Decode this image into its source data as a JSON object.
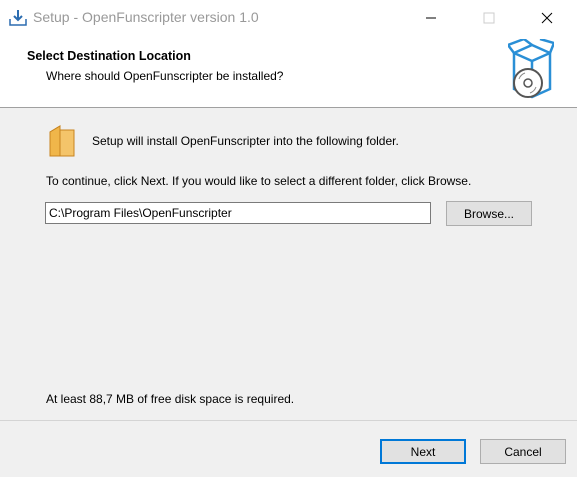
{
  "window": {
    "title": "Setup - OpenFunscripter version 1.0",
    "icon": "installer-download-icon",
    "controls": [
      "minimize-icon",
      "maximize-icon",
      "close-icon"
    ]
  },
  "header": {
    "title": "Select Destination Location",
    "subtitle": "Where should OpenFunscripter be installed?",
    "art_icon": "box-with-disc-icon"
  },
  "body": {
    "folder_icon": "folder-icon",
    "intro": "Setup will install OpenFunscripter into the following folder.",
    "continue_hint": "To continue, click Next. If you would like to select a different folder, click Browse.",
    "path_value": "C:\\Program Files\\OpenFunscripter",
    "browse_label": "Browse...",
    "disk_space": "At least 88,7 MB of free disk space is required."
  },
  "footer": {
    "next_label": "Next",
    "cancel_label": "Cancel"
  },
  "colors": {
    "accent": "#0078d7",
    "folder": "#f0b64a",
    "box": "#2a8fd6",
    "title_gray": "#999999"
  }
}
